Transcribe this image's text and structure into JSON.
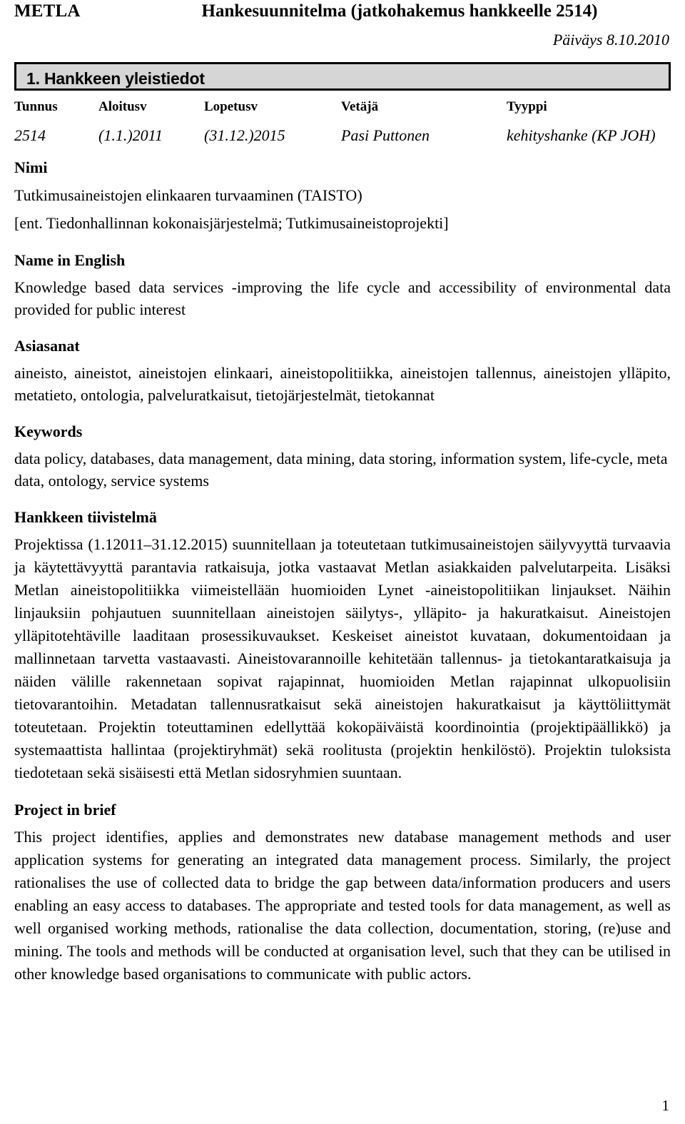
{
  "header": {
    "org": "METLA",
    "title": "Hankesuunnitelma (jatkohakemus hankkeelle 2514)",
    "date": "Päiväys 8.10.2010"
  },
  "section": {
    "heading": "1. Hankkeen yleistiedot"
  },
  "info_table": {
    "columns": [
      "Tunnus",
      "Aloitusv",
      "Lopetusv",
      "Vetäjä",
      "Tyyppi"
    ],
    "rows": [
      [
        "2514",
        "(1.1.)2011",
        "(31.12.)2015",
        "Pasi Puttonen",
        "kehityshanke (KP JOH)"
      ]
    ]
  },
  "fields": {
    "nimi_label": "Nimi",
    "nimi_line1": "Tutkimusaineistojen elinkaaren turvaaminen (TAISTO)",
    "nimi_line2": "[ent. Tiedonhallinnan kokonaisjärjestelmä; Tutkimusaineistoprojekti]",
    "name_en_label": "Name in English",
    "name_en_value": "Knowledge based data services -improving the life cycle and accessibility of environmental data provided for public interest",
    "asiasanat_label": "Asiasanat",
    "asiasanat_value": "aineisto, aineistot, aineistojen elinkaari, aineistopolitiikka, aineistojen tallennus, aineistojen ylläpito, metatieto, ontologia, palveluratkaisut, tietojärjestelmät, tietokannat",
    "keywords_label": "Keywords",
    "keywords_value": "data policy, databases, data management, data mining, data storing, information system, life-cycle, meta data, ontology, service systems",
    "tiivistelma_label": "Hankkeen tiivistelmä",
    "tiivistelma_value": "Projektissa (1.12011–31.12.2015) suunnitellaan ja toteutetaan tutkimusaineistojen säilyvyyttä turvaavia ja käytettävyyttä parantavia ratkaisuja, jotka vastaavat Metlan asiakkaiden palvelutarpeita. Lisäksi Metlan aineistopolitiikka viimeistellään huomioiden Lynet -aineistopolitiikan linjaukset. Näihin linjauksiin pohjautuen suunnitellaan aineistojen säilytys-, ylläpito- ja hakuratkaisut. Aineistojen ylläpitotehtäville laaditaan prosessikuvaukset. Keskeiset aineistot kuvataan, dokumentoidaan ja mallinnetaan tarvetta vastaavasti. Aineistovarannoille kehitetään tallennus- ja tietokantaratkaisuja ja näiden välille rakennetaan sopivat rajapinnat, huomioiden Metlan rajapinnat ulkopuolisiin tietovarantoihin. Metadatan tallennusratkaisut sekä aineistojen hakuratkaisut ja käyttöliittymät toteutetaan. Projektin toteuttaminen edellyttää kokopäiväistä koordinointia (projektipäällikkö) ja systemaattista hallintaa (projektiryhmät) sekä roolitusta (projektin henkilöstö). Projektin tuloksista tiedotetaan sekä sisäisesti että Metlan sidosryhmien suuntaan.",
    "brief_label": "Project in brief",
    "brief_value": "This project identifies, applies and demonstrates new database management methods and user application systems for generating an integrated data management process. Similarly, the project rationalises the use of collected data to bridge the gap between data/information producers and users enabling an easy access to databases. The appropriate and tested tools for data management, as well as well organised working methods, rationalise the data collection, documentation, storing, (re)use and mining. The tools and methods will be conducted at organisation level, such that they can be utilised in other knowledge based organisations to communicate with public actors."
  },
  "footer": {
    "page_number": "1"
  }
}
